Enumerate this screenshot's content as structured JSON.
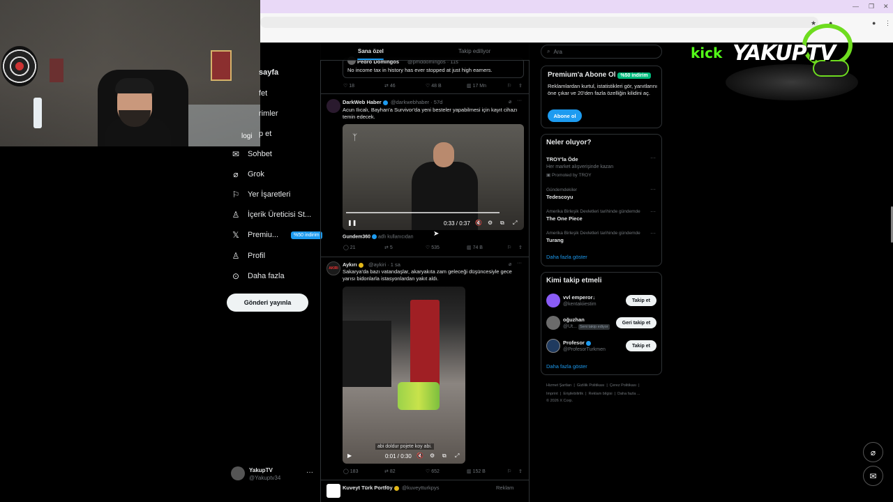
{
  "nav": {
    "partial_home": "sayfa",
    "partial_explore": "fet",
    "partial_notifications": "rimler",
    "partial_messages": "p et",
    "logi_overlay": "logi",
    "items": [
      {
        "label": "Sohbet",
        "icon": "chat-icon",
        "glyph": "✉"
      },
      {
        "label": "Grok",
        "icon": "grok-icon",
        "glyph": "⌀"
      },
      {
        "label": "Yer İşaretleri",
        "icon": "bookmark-icon",
        "glyph": "⚐"
      },
      {
        "label": "İçerik Üreticisi St...",
        "icon": "creator-studio-icon",
        "glyph": "♙"
      },
      {
        "label": "Premiu...",
        "icon": "x-logo-icon",
        "glyph": "𝕏"
      },
      {
        "label": "Profil",
        "icon": "profile-icon",
        "glyph": "♙"
      },
      {
        "label": "Daha fazla",
        "icon": "more-icon",
        "glyph": "⊙"
      }
    ],
    "premium_badge": "%50 indirim",
    "post_button": "Gönderi yayınla",
    "account": {
      "name": "YakupTV",
      "handle": "@Yakuptv34",
      "more": "···"
    }
  },
  "feed": {
    "tabs": [
      "Sana özel",
      "Takip ediliyor"
    ],
    "top_tweet": {
      "name": "Pedro Domingos",
      "handle": "@pmddomingos · 11s",
      "text": "No income tax in history has ever stopped at just high earners.",
      "actions": [
        "18",
        "46",
        "48 B",
        "17 Mn"
      ]
    },
    "tweet1": {
      "name": "DarkWeb Haber",
      "handle": "@darkwebhaber · 57d",
      "text": "Acun Ilıcalı, Bayhan'a Survivor'da yeni besteler yapabilmesi için kayıt cihazı temin edecek.",
      "video_time": "0:33 / 0:37",
      "source": "Gundem360",
      "source_note": "adlı kullanıcıdan",
      "actions": [
        "21",
        "5",
        "535",
        "74 B"
      ]
    },
    "tweet2": {
      "name": "Aykırı",
      "handle": "@aykiri · 1 sa",
      "avatar_text": "AKIRI",
      "text": "Sakarya'da bazı vatandaşlar, akaryakıta zam geleceği düşüncesiyle gece yarısı bidonlarla istasyonlardan yakıt aldı.",
      "subtitle": "abi doldur pojete koy abi.",
      "video_time": "0:01 / 0:30",
      "actions": [
        "183",
        "82",
        "652",
        "152 B"
      ]
    },
    "tweet3": {
      "name": "Kuveyt Türk Portföy",
      "handle": "@kuveytturkpys",
      "ad_label": "Reklam"
    }
  },
  "right": {
    "search_placeholder": "Ara",
    "premium": {
      "title": "Premium'a Abone Ol",
      "badge": "%50 indirim",
      "text": "Reklamlardan kurtul, istatistikleri gör, yanıtlarını öne çıkar ve 20'den fazla özelliğin kilidini aç.",
      "button": "Abone ol"
    },
    "trends": {
      "title": "Neler oluyor?",
      "items": [
        {
          "meta": "",
          "name": "TROY'la Öde",
          "sub": "Her market alışverişinde kazan",
          "promo": "Promoted by TROY"
        },
        {
          "meta": "Gündemdekiler",
          "name": "Tedescoyu"
        },
        {
          "meta": "Amerika Birleşik Devletleri tarihinde gündemde",
          "name": "The One Piece"
        },
        {
          "meta": "Amerika Birleşik Devletleri tarihinde gündemde",
          "name": "Turang"
        }
      ],
      "show_more": "Daha fazla göster"
    },
    "follow": {
      "title": "Kimi takip etmeli",
      "items": [
        {
          "name": "vvl emperor↓",
          "handle": "@kentakiiestim",
          "button": "Takip et",
          "avatar_color": "#8a5cf6"
        },
        {
          "name": "oğuzhan",
          "handle": "@Ut...",
          "follows_you": "Seni takip ediyor",
          "button": "Geri takip et",
          "avatar_color": "#6b6b6b"
        },
        {
          "name": "Profesor",
          "handle": "@ProfesorTurkmen",
          "button": "Takip et",
          "avatar_color": "#1f3a5f"
        }
      ],
      "show_more": "Daha fazla göster"
    },
    "footer": {
      "line1": [
        "Hizmet Şartları",
        "Gizlilik Politikası",
        "Çerez Politikası"
      ],
      "line2": [
        "Imprint",
        "Erişilebilirlik",
        "Reklam bilgisi",
        "Daha fazla ..."
      ],
      "copyright": "© 2026 X Corp."
    }
  },
  "overlay": {
    "kick": "kick",
    "brand": "YAKUPTV"
  },
  "colors": {
    "accent": "#1d9bf0",
    "green": "#00ba7c",
    "kick": "#53fc18"
  }
}
